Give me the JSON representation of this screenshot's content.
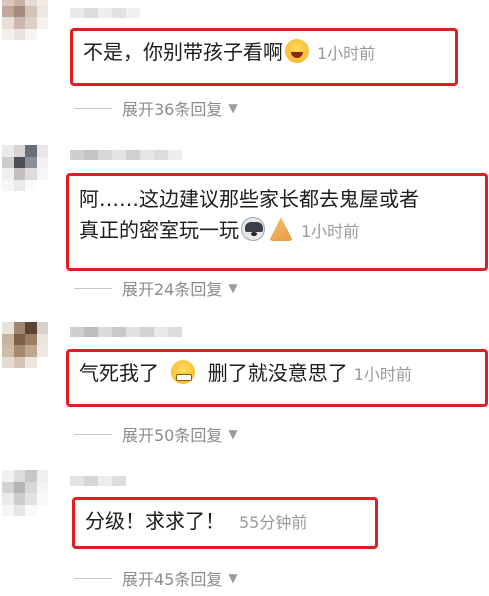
{
  "comments": [
    {
      "text": "不是，你别带孩子看啊",
      "emoji": "rolling-laugh-icon",
      "time": "1小时前",
      "expand": "展开36条回复"
    },
    {
      "text_line1": "阿……这边建议那些家长都去鬼屋或者",
      "text_line2": "真正的密室玩一玩",
      "emoji1": "dog-face-icon",
      "emoji2": "folded-hands-icon",
      "time": "1小时前",
      "expand": "展开24条回复"
    },
    {
      "text_before": "气死我了",
      "emoji": "angry-grimace-icon",
      "text_after": "删了就没意思了",
      "time": "1小时前",
      "expand": "展开50条回复"
    },
    {
      "text": "分级！求求了！",
      "time": "55分钟前",
      "expand": "展开45条回复"
    }
  ],
  "colors": {
    "highlight_border": "#e01e24",
    "time_text": "#9a9a9a",
    "expand_text": "#8b8b8b"
  },
  "icons": {
    "expand_caret": "▼"
  }
}
